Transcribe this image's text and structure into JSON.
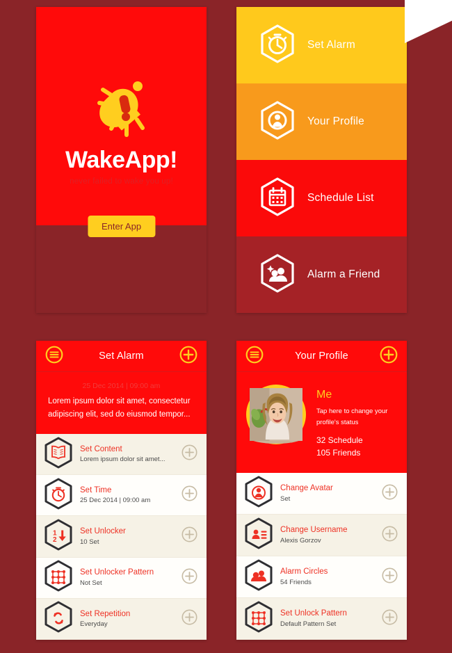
{
  "splash": {
    "logo_icon": "alarm-bell-icon",
    "title": "WakeApp!",
    "tagline": "never failed to wake you up!",
    "enter_button": "Enter App",
    "colors": {
      "red": "#FF0A0A",
      "maroon": "#8A2428",
      "yellow": "#FFCE1F"
    }
  },
  "menu": {
    "items": [
      {
        "label": "Set Alarm",
        "icon": "stopwatch-icon",
        "bg": "#FFC91C"
      },
      {
        "label": "Your Profile",
        "icon": "user-circle-icon",
        "bg": "#F89A1C"
      },
      {
        "label": "Schedule List",
        "icon": "calendar-icon",
        "bg": "#FB0A0A"
      },
      {
        "label": "Alarm a Friend",
        "icon": "add-friend-icon",
        "bg": "#A52226"
      }
    ]
  },
  "set_alarm": {
    "header": {
      "menu_icon": "hamburger-menu-icon",
      "title": "Set Alarm",
      "add_icon": "plus-circle-icon"
    },
    "hero": {
      "date": "25 Dec 2014 | 09:00 am",
      "text": "Lorem ipsum dolor sit amet, consectetur adipiscing elit, sed do eiusmod tempor..."
    },
    "rows": [
      {
        "icon": "book-icon",
        "title": "Set Content",
        "sub": "Lorem ipsum dolor sit amet...",
        "action_icon": "plus-circle-icon"
      },
      {
        "icon": "alarm-clock-icon",
        "title": "Set Time",
        "sub": "25 Dec 2014 | 09:00 am",
        "action_icon": "plus-circle-icon"
      },
      {
        "icon": "number-order-icon",
        "title": "Set Unlocker",
        "sub": "10 Set",
        "action_icon": "plus-circle-icon"
      },
      {
        "icon": "pattern-grid-icon",
        "title": "Set Unlocker Pattern",
        "sub": "Not Set",
        "action_icon": "plus-circle-icon"
      },
      {
        "icon": "repeat-icon",
        "title": "Set Repetition",
        "sub": "Everyday",
        "action_icon": "plus-circle-icon"
      }
    ]
  },
  "profile": {
    "header": {
      "menu_icon": "hamburger-menu-icon",
      "title": "Your Profile",
      "add_icon": "plus-circle-icon"
    },
    "hero": {
      "avatar": "user-photo-avatar",
      "name": "Me",
      "status": "Tap here to change your profile's status",
      "schedule_count": "32 Schedule",
      "friends_count": "105 Friends"
    },
    "rows": [
      {
        "icon": "avatar-circle-icon",
        "title": "Change Avatar",
        "sub": "Set",
        "action_icon": "plus-circle-icon"
      },
      {
        "icon": "id-card-icon",
        "title": "Change Username",
        "sub": "Alexis Gorzov",
        "action_icon": "plus-circle-icon"
      },
      {
        "icon": "people-icon",
        "title": "Alarm Circles",
        "sub": "54 Friends",
        "action_icon": "plus-circle-icon"
      },
      {
        "icon": "pattern-grid-icon",
        "title": "Set Unlock Pattern",
        "sub": "Default Pattern Set",
        "action_icon": "plus-circle-icon"
      }
    ]
  }
}
